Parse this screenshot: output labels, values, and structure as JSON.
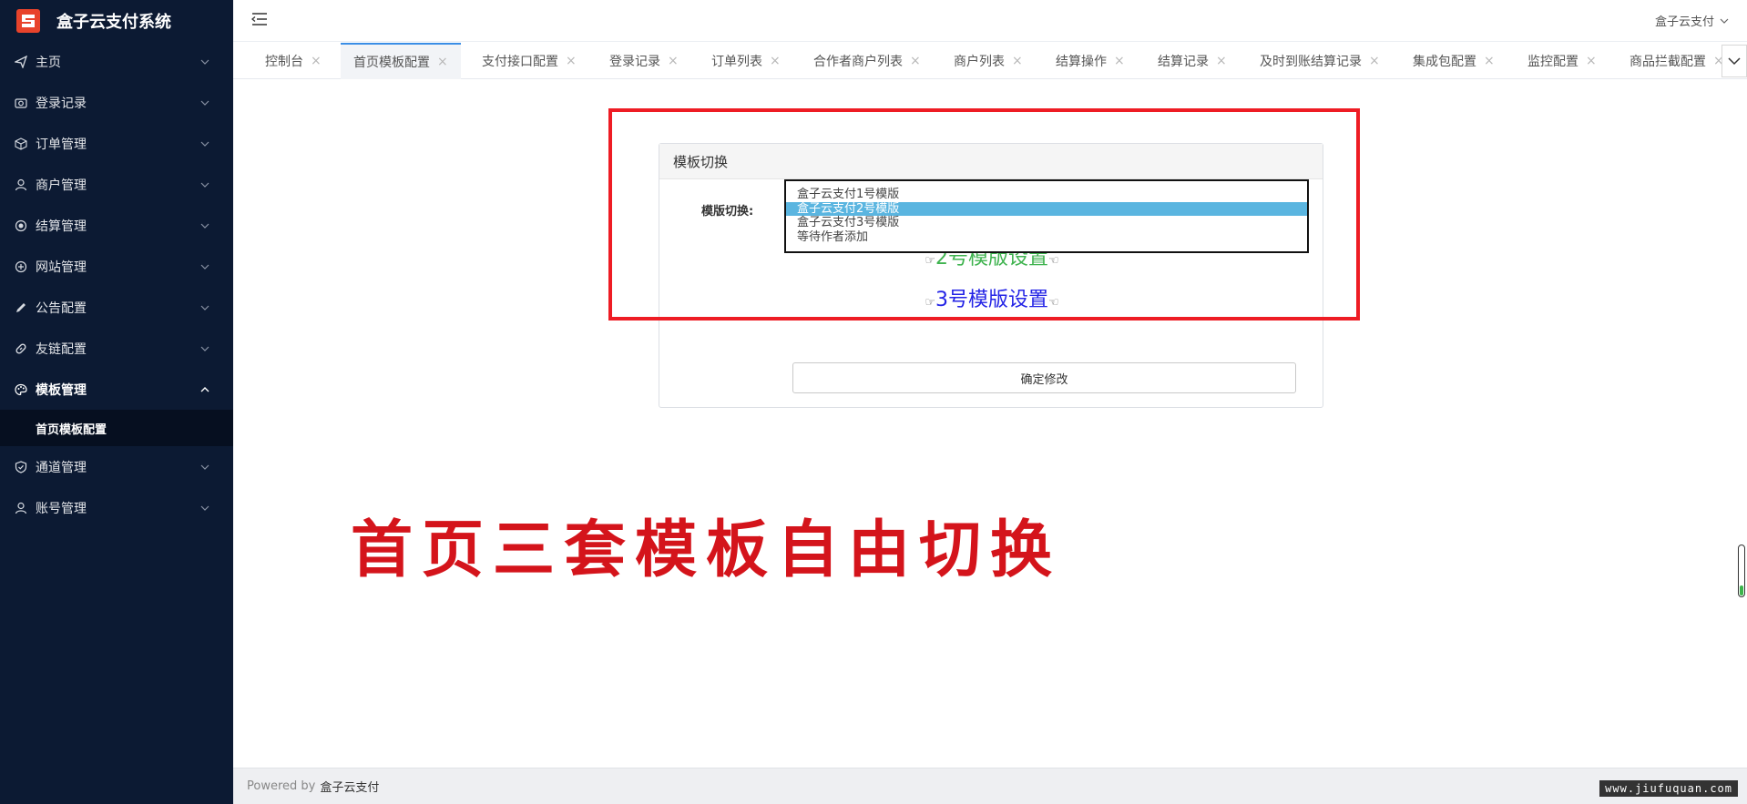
{
  "app": {
    "title": "盒子云支付系统",
    "colors": {
      "sidebar_bg": "#0c1a33",
      "accent": "#3a8ee6",
      "highlight": "#ee1c24"
    }
  },
  "sidebar": {
    "items": [
      {
        "label": "主页",
        "icon": "send-icon"
      },
      {
        "label": "登录记录",
        "icon": "camera-icon"
      },
      {
        "label": "订单管理",
        "icon": "box-icon"
      },
      {
        "label": "商户管理",
        "icon": "user-icon"
      },
      {
        "label": "结算管理",
        "icon": "radio-icon"
      },
      {
        "label": "网站管理",
        "icon": "plus-circle-icon"
      },
      {
        "label": "公告配置",
        "icon": "pencil-icon"
      },
      {
        "label": "友链配置",
        "icon": "link-icon"
      },
      {
        "label": "模板管理",
        "icon": "palette-icon",
        "open": true
      },
      {
        "label": "通道管理",
        "icon": "shield-icon"
      },
      {
        "label": "账号管理",
        "icon": "user-icon"
      }
    ],
    "subitem": "首页模板配置"
  },
  "header": {
    "user": "盒子云支付"
  },
  "tabs": [
    {
      "label": "控制台"
    },
    {
      "label": "首页模板配置",
      "active": true
    },
    {
      "label": "支付接口配置"
    },
    {
      "label": "登录记录"
    },
    {
      "label": "订单列表"
    },
    {
      "label": "合作者商户列表"
    },
    {
      "label": "商户列表"
    },
    {
      "label": "结算操作"
    },
    {
      "label": "结算记录"
    },
    {
      "label": "及时到账结算记录"
    },
    {
      "label": "集成包配置"
    },
    {
      "label": "监控配置"
    },
    {
      "label": "商品拦截配置"
    }
  ],
  "tab_close": "×",
  "panel": {
    "title": "模板切换",
    "field_label": "模版切换:",
    "options": [
      {
        "label": "盒子云支付1号模版"
      },
      {
        "label": "盒子云支付2号模版",
        "selected": true
      },
      {
        "label": "盒子云支付3号模版"
      },
      {
        "label": "等待作者添加"
      }
    ],
    "link2": "2号模版设置",
    "link3": "3号模版设置",
    "hand_left": "☞",
    "hand_right": "☜",
    "submit": "确定修改"
  },
  "caption": "首页三套模板自由切换",
  "footer": {
    "powered_by": "Powered by",
    "brand": "盒子云支付"
  },
  "watermark": "www.jiufuquan.com",
  "scroll_indicator_fill": 0.2
}
